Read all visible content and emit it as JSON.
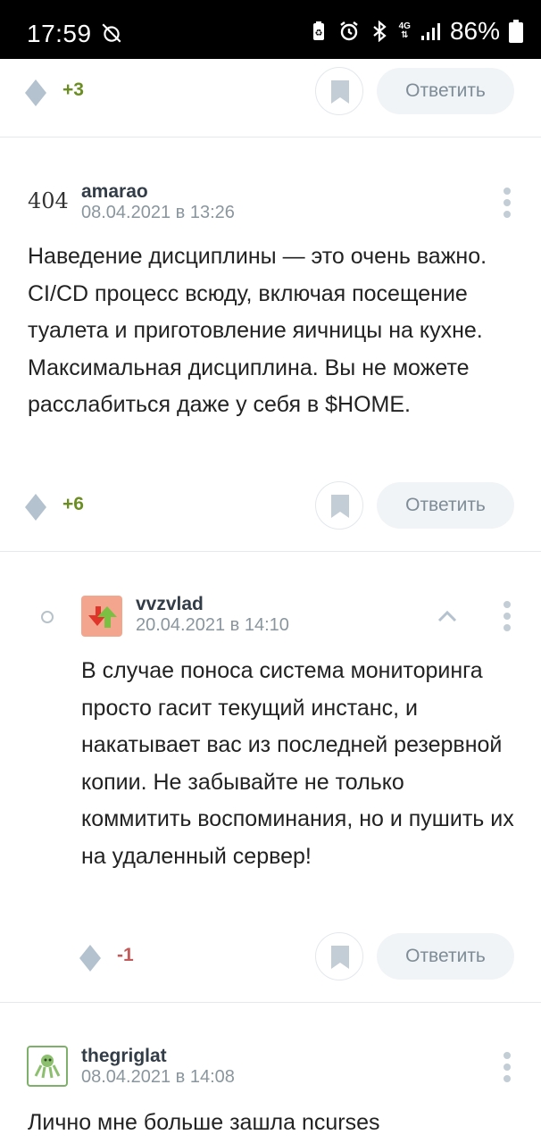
{
  "status_bar": {
    "time": "17:59",
    "battery": "86%",
    "network": "4G",
    "icons": [
      "alarm-off-icon",
      "battery-saver-icon",
      "alarm-icon",
      "bluetooth-icon",
      "4g-icon",
      "signal-icon",
      "battery-icon"
    ]
  },
  "reply_label": "Ответить",
  "top_action": {
    "score": "+3"
  },
  "comments": [
    {
      "avatar": "404",
      "username": "amarao",
      "timestamp": "08.04.2021 в 13:26",
      "text": "Наведение дисциплины — это очень важно. CI/CD процесс всюду, включая посещение туалета и приготовление яичницы на кухне. Максимальная дисциплина. Вы не можете расслабиться даже у себя в $HOME.",
      "score": "+6"
    },
    {
      "avatar": "arrows-avatar",
      "username": "vvzvlad",
      "timestamp": "20.04.2021 в 14:10",
      "text": "В случае поноса система мониторинга просто гасит текущий инстанс, и накатывает вас из последней резервной копии. Не забывайте не только коммитить воспоминания, но и пушить их на удаленный сервер!",
      "score": "-1"
    },
    {
      "avatar": "octopus-avatar",
      "username": "thegriglat",
      "timestamp": "08.04.2021 в 14:08",
      "text": "Лично мне больше зашла ncurses"
    }
  ],
  "colors": {
    "positive_score": "#6b8e23",
    "negative_score": "#c45b5b",
    "reply_bg": "#f1f4f6",
    "muted": "#8a969e"
  }
}
